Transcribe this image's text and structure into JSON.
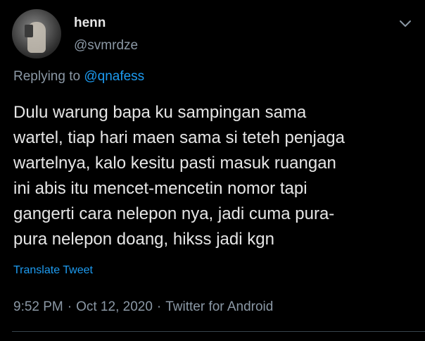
{
  "tweet": {
    "display_name": "henn",
    "handle": "@svmrdze",
    "reply_prefix": "Replying to",
    "reply_mention": "@qnafess",
    "text": "Dulu warung bapa ku sampingan sama\nwartel, tiap hari maen sama si teteh penjaga\nwartelnya, kalo kesitu pasti masuk ruangan\nini abis itu mencet-mencetin nomor tapi\ngangerti cara nelepon nya, jadi cuma pura-\npura nelepon doang, hikss jadi kgn",
    "translate_label": "Translate Tweet",
    "time": "9:52 PM",
    "date": "Oct 12, 2020",
    "source": "Twitter for Android",
    "separator": "·"
  },
  "icons": {
    "avatar": "user-avatar",
    "menu": "chevron-down-icon"
  },
  "colors": {
    "background": "#000000",
    "text_primary": "#e6e6e6",
    "text_secondary": "#8b98a5",
    "link": "#1d9bf0",
    "divider": "#38444d"
  }
}
